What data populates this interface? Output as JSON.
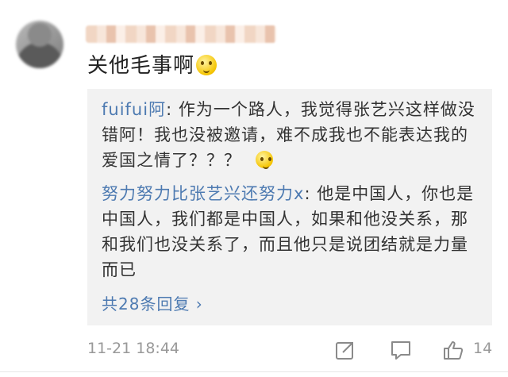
{
  "comment": {
    "text": "关他毛事啊",
    "emoji": "confused-face-emoji"
  },
  "replies": [
    {
      "author": "fuifui阿",
      "text": ": 作为一个路人，我觉得张艺兴这样做没错阿！我也没被邀请，难不成我也不能表达我的爱国之情了？？？",
      "emoji": "smile-emoji"
    },
    {
      "author": "努力努力比张艺兴还努力x",
      "text": ": 他是中国人，你也是中国人，我们都是中国人，如果和他没关系，那和我们也没关系了，而且他只是说团结就是力量而已"
    }
  ],
  "more_replies": "共28条回复 ›",
  "footer": {
    "timestamp": "11-21 18:44",
    "like_count": "14"
  },
  "colors": {
    "link": "#4d7ab1",
    "reply_bg": "#f2f2f2",
    "meta": "#999999"
  }
}
